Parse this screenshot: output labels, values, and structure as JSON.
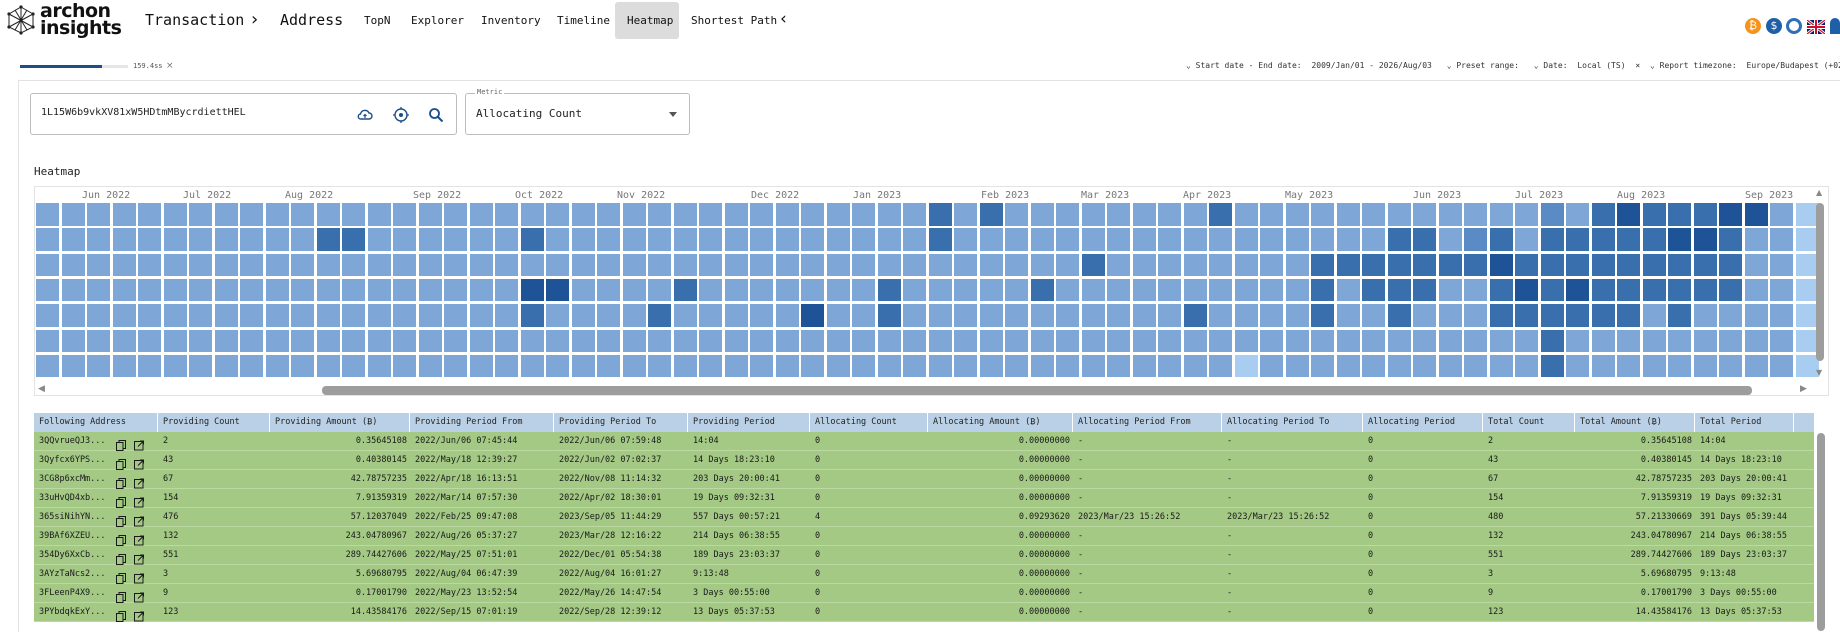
{
  "app": {
    "logo_line1": "archon",
    "logo_line2": "insights"
  },
  "nav": {
    "transaction": "Transaction",
    "address": "Address",
    "items": [
      "TopN",
      "Explorer",
      "Inventory",
      "Timeline",
      "Heatmap",
      "Shortest Path"
    ],
    "active": "Heatmap"
  },
  "toolbar_icons": [
    "bitcoin-icon",
    "stablecoin-icon",
    "refresh-icon",
    "uk-flag-icon"
  ],
  "progress": {
    "label": "159.4ss",
    "fraction": 0.76
  },
  "filters": {
    "date_range_label": "Start date - End date:",
    "date_range_value": "2009/Jan/01 - 2026/Aug/03",
    "preset_label": "Preset range:",
    "date_label": "Date:",
    "date_value": "Local (TS)",
    "timezone_label": "Report timezone:",
    "timezone_value": "Europe/Budapest (+02:00)"
  },
  "search": {
    "value": "1L15W6b9vkXV81xW5HDtmMBycrdiettHEL"
  },
  "metric": {
    "legend": "Metric",
    "value": "Allocating Count"
  },
  "heatmap": {
    "title": "Heatmap",
    "months": [
      "Jun 2022",
      "Jul 2022",
      "Aug 2022",
      "Sep 2022",
      "Oct 2022",
      "Nov 2022",
      "Dec 2022",
      "Jan 2023",
      "Feb 2023",
      "Mar 2023",
      "Apr 2023",
      "May 2023",
      "Jun 2023",
      "Jul 2023",
      "Aug 2023",
      "Sep 2023"
    ],
    "palette": [
      "#7ea7d8",
      "#5b8bc4",
      "#3a6fae",
      "#1e5497",
      "#a9cdf0"
    ],
    "levels": [
      "00000000000000000000000000000000000002000000000000000000000000000000000000000000000",
      "000000000000200000000000000000000000000000000000000000000000000000000000000000000",
      "000000000000000000000000000000000000000000000000000000000000000000000000000000000",
      "000000000000000000000000000000000000000000000000000000000000000000000000000000000",
      "000000000000000000000000000000000000000000000000000000000000000000000000000000000",
      "000000000000000000000000000000000000000000000000000000000000000000000000000000000",
      "000000000000000000000000000000000000000000000000000000000000000000000000000000000"
    ]
  },
  "table": {
    "columns": [
      "Following Address",
      "Providing Count",
      "Providing Amount (₿)",
      "Providing Period From",
      "Providing Period To",
      "Providing Period",
      "Allocating Count",
      "Allocating Amount (₿)",
      "Allocating Period From",
      "Allocating Period To",
      "Allocating Period",
      "Total Count",
      "Total Amount (₿)",
      "Total Period"
    ],
    "rows": [
      [
        "3QQvrueQJ3...",
        "2",
        "0.35645108",
        "2022/Jun/06 07:45:44",
        "2022/Jun/06 07:59:48",
        "14:04",
        "0",
        "0.00000000",
        "-",
        "-",
        "0",
        "2",
        "0.35645108",
        "14:04"
      ],
      [
        "3Qyfcx6YPS...",
        "43",
        "0.40380145",
        "2022/May/18 12:39:27",
        "2022/Jun/02 07:02:37",
        "14 Days 18:23:10",
        "0",
        "0.00000000",
        "-",
        "-",
        "0",
        "43",
        "0.40380145",
        "14 Days 18:23:10"
      ],
      [
        "3CG8p6xcMm...",
        "67",
        "42.78757235",
        "2022/Apr/18 16:13:51",
        "2022/Nov/08 11:14:32",
        "203 Days 20:00:41",
        "0",
        "0.00000000",
        "-",
        "-",
        "0",
        "67",
        "42.78757235",
        "203 Days 20:00:41"
      ],
      [
        "33uHvQD4xb...",
        "154",
        "7.91359319",
        "2022/Mar/14 07:57:30",
        "2022/Apr/02 18:30:01",
        "19 Days 09:32:31",
        "0",
        "0.00000000",
        "-",
        "-",
        "0",
        "154",
        "7.91359319",
        "19 Days 09:32:31"
      ],
      [
        "365siNihYN...",
        "476",
        "57.12037049",
        "2022/Feb/25 09:47:08",
        "2023/Sep/05 11:44:29",
        "557 Days 00:57:21",
        "4",
        "0.09293620",
        "2023/Mar/23 15:26:52",
        "2023/Mar/23 15:26:52",
        "0",
        "480",
        "57.21330669",
        "391 Days 05:39:44"
      ],
      [
        "39BAf6XZEU...",
        "132",
        "243.04780967",
        "2022/Aug/26 05:37:27",
        "2023/Mar/28 12:16:22",
        "214 Days 06:38:55",
        "0",
        "0.00000000",
        "-",
        "-",
        "0",
        "132",
        "243.04780967",
        "214 Days 06:38:55"
      ],
      [
        "354Dy6XxCb...",
        "551",
        "289.74427606",
        "2022/May/25 07:51:01",
        "2022/Dec/01 05:54:38",
        "189 Days 23:03:37",
        "0",
        "0.00000000",
        "-",
        "-",
        "0",
        "551",
        "289.74427606",
        "189 Days 23:03:37"
      ],
      [
        "3AYzTaNcs2...",
        "3",
        "5.69680795",
        "2022/Aug/04 06:47:39",
        "2022/Aug/04 16:01:27",
        "9:13:48",
        "0",
        "0.00000000",
        "-",
        "-",
        "0",
        "3",
        "5.69680795",
        "9:13:48"
      ],
      [
        "3FLeenP4X9...",
        "9",
        "0.17001790",
        "2022/May/23 13:52:54",
        "2022/May/26 14:47:54",
        "3 Days 00:55:00",
        "0",
        "0.00000000",
        "-",
        "-",
        "0",
        "9",
        "0.17001790",
        "3 Days 00:55:00"
      ],
      [
        "3PYbdqkExY...",
        "123",
        "14.43584176",
        "2022/Sep/15 07:01:19",
        "2022/Sep/28 12:39:12",
        "13 Days 05:37:53",
        "0",
        "0.00000000",
        "-",
        "-",
        "0",
        "123",
        "14.43584176",
        "13 Days 05:37:53"
      ]
    ]
  }
}
